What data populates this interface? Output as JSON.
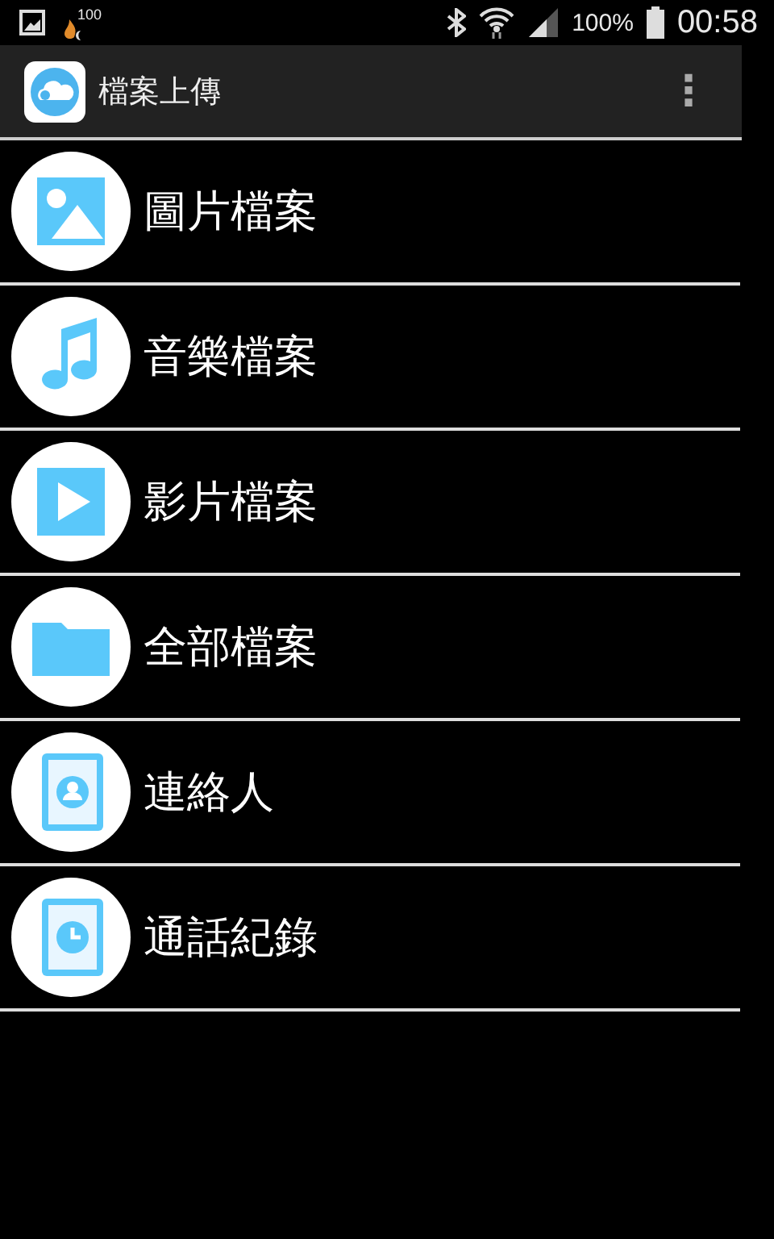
{
  "status_bar": {
    "notification_badge": "100",
    "battery": "100%",
    "time": "00:58"
  },
  "app_bar": {
    "title": "檔案上傳",
    "menu_icon": "⋮"
  },
  "items": [
    {
      "kind": "image",
      "label": "圖片檔案"
    },
    {
      "kind": "music",
      "label": "音樂檔案"
    },
    {
      "kind": "video",
      "label": "影片檔案"
    },
    {
      "kind": "folder",
      "label": "全部檔案"
    },
    {
      "kind": "contacts",
      "label": "連絡人"
    },
    {
      "kind": "calllog",
      "label": "通話紀錄"
    }
  ]
}
